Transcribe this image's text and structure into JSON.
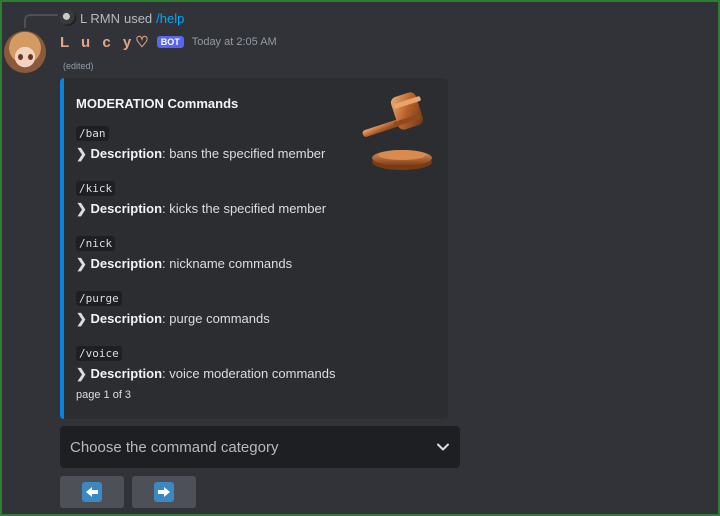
{
  "reply": {
    "user": "L RMN",
    "used_text": "used",
    "command": "/help"
  },
  "message": {
    "username": "L u c y♡",
    "badge": "BOT",
    "timestamp": "Today at 2:05 AM",
    "edited": "(edited)"
  },
  "embed": {
    "accent_color": "#0b84e0",
    "title": "MODERATION Commands",
    "thumbnail": "gavel-icon",
    "fields": [
      {
        "command": "/ban",
        "arrow": "❯",
        "label": "Description",
        "text": ": bans the specified member"
      },
      {
        "command": "/kick",
        "arrow": "❯",
        "label": "Description",
        "text": ": kicks the specified member"
      },
      {
        "command": "/nick",
        "arrow": "❯",
        "label": "Description",
        "text": ": nickname commands"
      },
      {
        "command": "/purge",
        "arrow": "❯",
        "label": "Description",
        "text": ": purge commands"
      },
      {
        "command": "/voice",
        "arrow": "❯",
        "label": "Description",
        "text": ": voice moderation commands"
      }
    ],
    "footer": "page 1 of 3"
  },
  "select_menu": {
    "placeholder": "Choose the command category",
    "icon": "chevron-down-icon"
  },
  "buttons": [
    {
      "icon": "arrow-left-icon"
    },
    {
      "icon": "arrow-right-icon"
    }
  ]
}
